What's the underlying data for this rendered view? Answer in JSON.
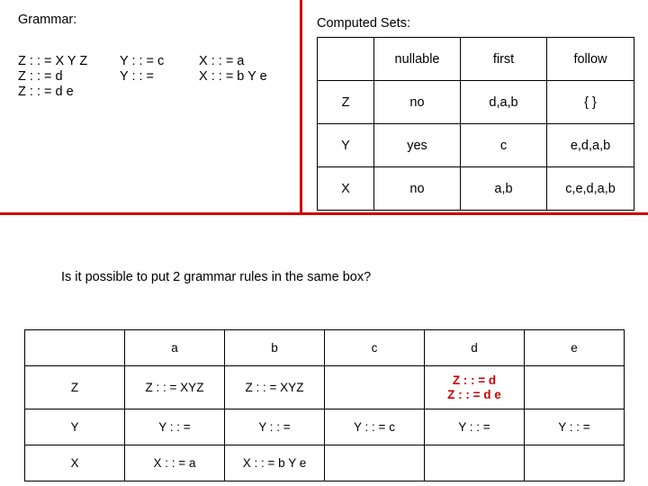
{
  "grammar": {
    "label": "Grammar:",
    "columns": [
      "Z : : = X Y Z\nZ : : = d\nZ : : = d e",
      "Y : : = c\nY : : =",
      "X : : = a\nX : : = b Y e"
    ]
  },
  "computed_sets": {
    "label": "Computed Sets:",
    "headers": [
      "",
      "nullable",
      "first",
      "follow"
    ],
    "rows": [
      [
        "Z",
        "no",
        "d,a,b",
        "{ }"
      ],
      [
        "Y",
        "yes",
        "c",
        "e,d,a,b"
      ],
      [
        "X",
        "no",
        "a,b",
        "c,e,d,a,b"
      ]
    ]
  },
  "question": "Is it possible to put 2 grammar rules in the same box?",
  "box_table": {
    "headers": [
      "",
      "a",
      "b",
      "c",
      "d",
      "e"
    ],
    "rows": [
      {
        "cells": [
          "Z",
          "Z : : = XYZ",
          "Z : : = XYZ",
          "",
          "Z : : = d\nZ : : = d e",
          ""
        ],
        "highlight": [
          false,
          false,
          false,
          false,
          true,
          false
        ]
      },
      {
        "cells": [
          "Y",
          "Y : : =",
          "Y : : =",
          "Y : : = c",
          "Y : : =",
          "Y : : ="
        ],
        "highlight": [
          false,
          false,
          false,
          false,
          false,
          false
        ]
      },
      {
        "cells": [
          "X",
          "X : : = a",
          "X : : = b Y e",
          "",
          "",
          ""
        ],
        "highlight": [
          false,
          false,
          false,
          false,
          false,
          false
        ]
      }
    ]
  },
  "colors": {
    "accent_red": "#cc0000",
    "text": "#000000",
    "background": "#ffffff"
  }
}
